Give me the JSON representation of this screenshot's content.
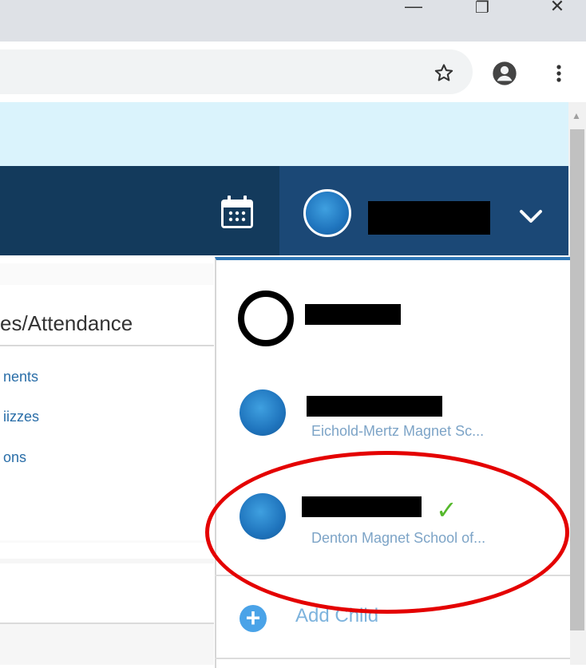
{
  "window": {
    "minimize_glyph": "—",
    "restore_glyph": "❐",
    "close_glyph": "✕"
  },
  "toolbar": {
    "icons": [
      "star-icon",
      "profile-icon",
      "menu-dots-icon"
    ]
  },
  "left_panel": {
    "title": "es/Attendance",
    "links": [
      "nents",
      "iizzes",
      "ons"
    ]
  },
  "account_menu": {
    "selected_icon": "chevron-down-icon",
    "children": [
      {
        "name": "",
        "school": ""
      },
      {
        "name": "",
        "school": "Eichold-Mertz Magnet Sc..."
      },
      {
        "name": "",
        "school": "Denton Magnet School of...",
        "selected": true
      }
    ],
    "add_child_label": "Add Child"
  },
  "colors": {
    "nav": "#133a5c",
    "accent": "#2f77b7",
    "check": "#55b82c",
    "annotation": "#e40000"
  }
}
